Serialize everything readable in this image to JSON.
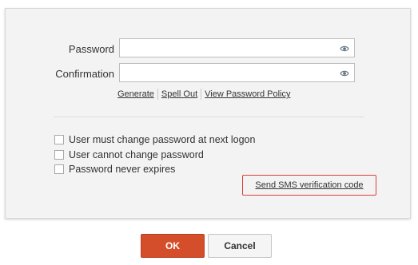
{
  "password_field": {
    "label": "Password",
    "value": "",
    "reveal_icon": "eye-icon"
  },
  "confirmation_field": {
    "label": "Confirmation",
    "value": "",
    "reveal_icon": "eye-icon"
  },
  "links": {
    "generate": "Generate",
    "spell_out": "Spell Out",
    "view_policy": "View Password Policy"
  },
  "options": {
    "must_change": {
      "label": "User must change password at next logon",
      "checked": false
    },
    "cannot_change": {
      "label": "User cannot change password",
      "checked": false
    },
    "never_expires": {
      "label": "Password never expires",
      "checked": false
    }
  },
  "sms_button": {
    "label": "Send SMS verification code",
    "border_color": "#d9403a"
  },
  "buttons": {
    "ok": "OK",
    "cancel": "Cancel",
    "ok_color": "#d54e2b"
  }
}
